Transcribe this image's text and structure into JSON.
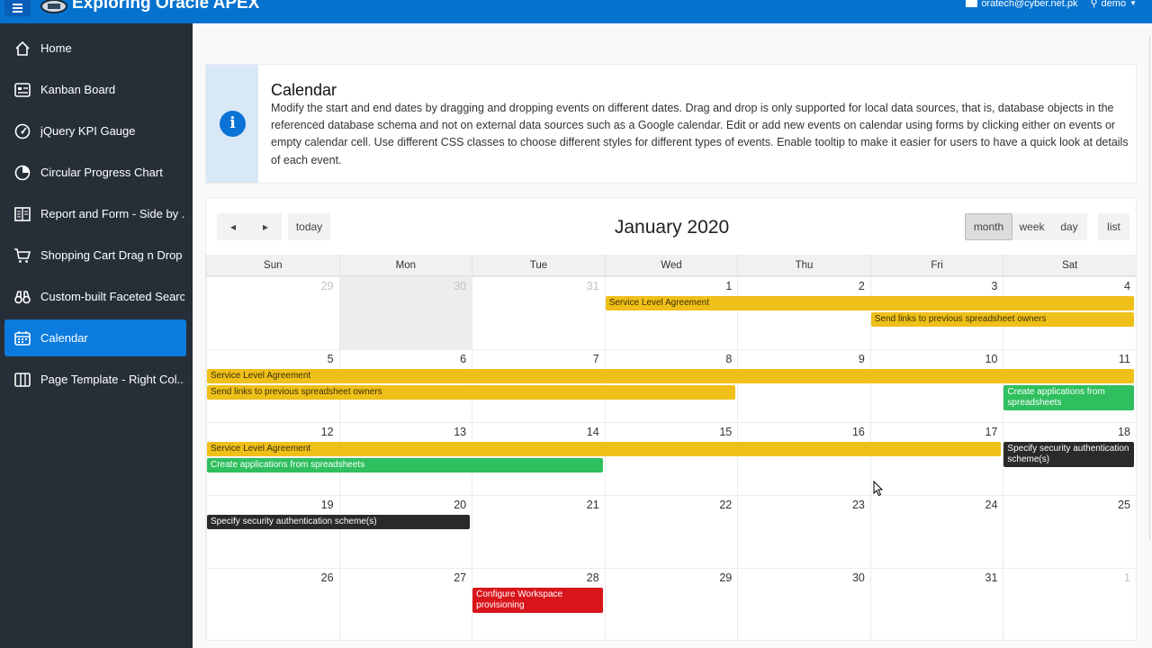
{
  "header": {
    "app_title": "Exploring Oracle APEX",
    "email": "oratech@cyber.net.pk",
    "user": "demo"
  },
  "sidebar": {
    "items": [
      {
        "label": "Home",
        "icon": "home-icon"
      },
      {
        "label": "Kanban Board",
        "icon": "kanban-icon"
      },
      {
        "label": "jQuery KPI Gauge",
        "icon": "gauge-icon"
      },
      {
        "label": "Circular Progress Chart",
        "icon": "circular-chart-icon"
      },
      {
        "label": "Report and Form - Side by ...",
        "icon": "report-form-icon"
      },
      {
        "label": "Shopping Cart Drag n Drop",
        "icon": "cart-icon"
      },
      {
        "label": "Custom-built Faceted Search",
        "icon": "binoculars-icon"
      },
      {
        "label": "Calendar",
        "icon": "calendar-icon",
        "active": true
      },
      {
        "label": "Page Template - Right Col...",
        "icon": "columns-icon"
      }
    ]
  },
  "info": {
    "title": "Calendar",
    "text": "Modify the start and end dates by dragging and dropping events on different dates. Drag and drop is only supported for local data sources, that is, database objects in the referenced database schema and not on external data sources such as a Google calendar. Edit or add new events on calendar using forms by clicking either on events or empty calendar cell. Use different CSS classes to choose different styles for different types of events. Enable tooltip to make it easier for users to have a quick look at details of each event."
  },
  "calendar": {
    "title": "January 2020",
    "prev_label": "◂",
    "next_label": "▸",
    "today_label": "today",
    "views": [
      "month",
      "week",
      "day",
      "list"
    ],
    "active_view": "month",
    "days_of_week": [
      "Sun",
      "Mon",
      "Tue",
      "Wed",
      "Thu",
      "Fri",
      "Sat"
    ],
    "weeks": [
      [
        "29",
        "30",
        "31",
        "1",
        "2",
        "3",
        "4"
      ],
      [
        "5",
        "6",
        "7",
        "8",
        "9",
        "10",
        "11"
      ],
      [
        "12",
        "13",
        "14",
        "15",
        "16",
        "17",
        "18"
      ],
      [
        "19",
        "20",
        "21",
        "22",
        "23",
        "24",
        "25"
      ],
      [
        "26",
        "27",
        "28",
        "29",
        "30",
        "31",
        "1"
      ]
    ],
    "events": [
      {
        "title": "Service Level Agreement",
        "week": 0,
        "start": 3,
        "end": 6,
        "row": 0,
        "color": "yellow"
      },
      {
        "title": "Send links to previous spreadsheet owners",
        "week": 0,
        "start": 5,
        "end": 6,
        "row": 1,
        "color": "yellow"
      },
      {
        "title": "Service Level Agreement",
        "week": 1,
        "start": 0,
        "end": 6,
        "row": 0,
        "color": "yellow"
      },
      {
        "title": "Send links to previous spreadsheet owners",
        "week": 1,
        "start": 0,
        "end": 3,
        "row": 1,
        "color": "yellow"
      },
      {
        "title": "Create applications from spreadsheets",
        "week": 1,
        "start": 6,
        "end": 6,
        "row": 1,
        "color": "green"
      },
      {
        "title": "Service Level Agreement",
        "week": 2,
        "start": 0,
        "end": 5,
        "row": 0,
        "color": "yellow"
      },
      {
        "title": "Create applications from spreadsheets",
        "week": 2,
        "start": 0,
        "end": 2,
        "row": 1,
        "color": "green"
      },
      {
        "title": "Specify security authentication scheme(s)",
        "week": 2,
        "start": 6,
        "end": 6,
        "row": 0,
        "color": "dark"
      },
      {
        "title": "Specify security authentication scheme(s)",
        "week": 3,
        "start": 0,
        "end": 1,
        "row": 0,
        "color": "dark"
      },
      {
        "title": "Configure Workspace provisioning",
        "week": 4,
        "start": 2,
        "end": 2,
        "row": 0,
        "color": "red"
      }
    ]
  }
}
